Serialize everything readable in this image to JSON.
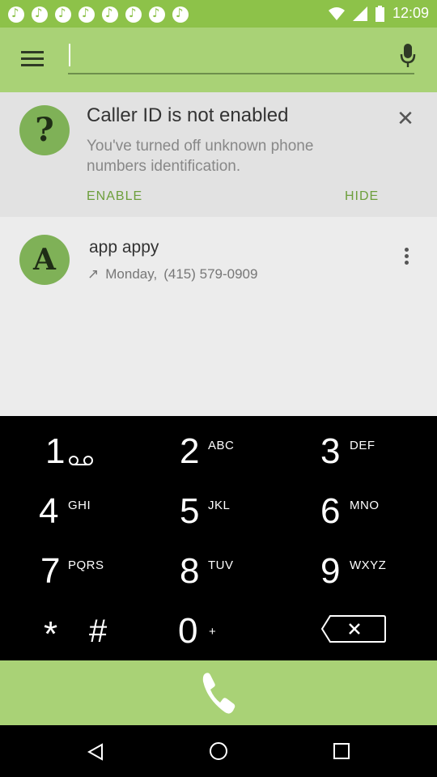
{
  "status_bar": {
    "time": "12:09"
  },
  "search": {
    "placeholder": ""
  },
  "caller_id": {
    "title": "Caller ID is not enabled",
    "description": "You've turned off unknown phone numbers identification.",
    "enable_label": "ENABLE",
    "hide_label": "HIDE",
    "icon_glyph": "?"
  },
  "call_log": {
    "avatar_letter": "A",
    "name": "app appy",
    "day": "Monday,",
    "number": "(415) 579-0909"
  },
  "dialpad": {
    "keys": [
      {
        "digit": "1",
        "letters": ""
      },
      {
        "digit": "2",
        "letters": "ABC"
      },
      {
        "digit": "3",
        "letters": "DEF"
      },
      {
        "digit": "4",
        "letters": "GHI"
      },
      {
        "digit": "5",
        "letters": "JKL"
      },
      {
        "digit": "6",
        "letters": "MNO"
      },
      {
        "digit": "7",
        "letters": "PQRS"
      },
      {
        "digit": "8",
        "letters": "TUV"
      },
      {
        "digit": "9",
        "letters": "WXYZ"
      },
      {
        "digit": "*",
        "letters": ""
      },
      {
        "digit": "#",
        "letters": ""
      },
      {
        "digit": "0",
        "letters": "+"
      }
    ]
  },
  "colors": {
    "accent": "#a9d276",
    "status_bar": "#8dc249",
    "dialpad_bg": "#000000"
  }
}
